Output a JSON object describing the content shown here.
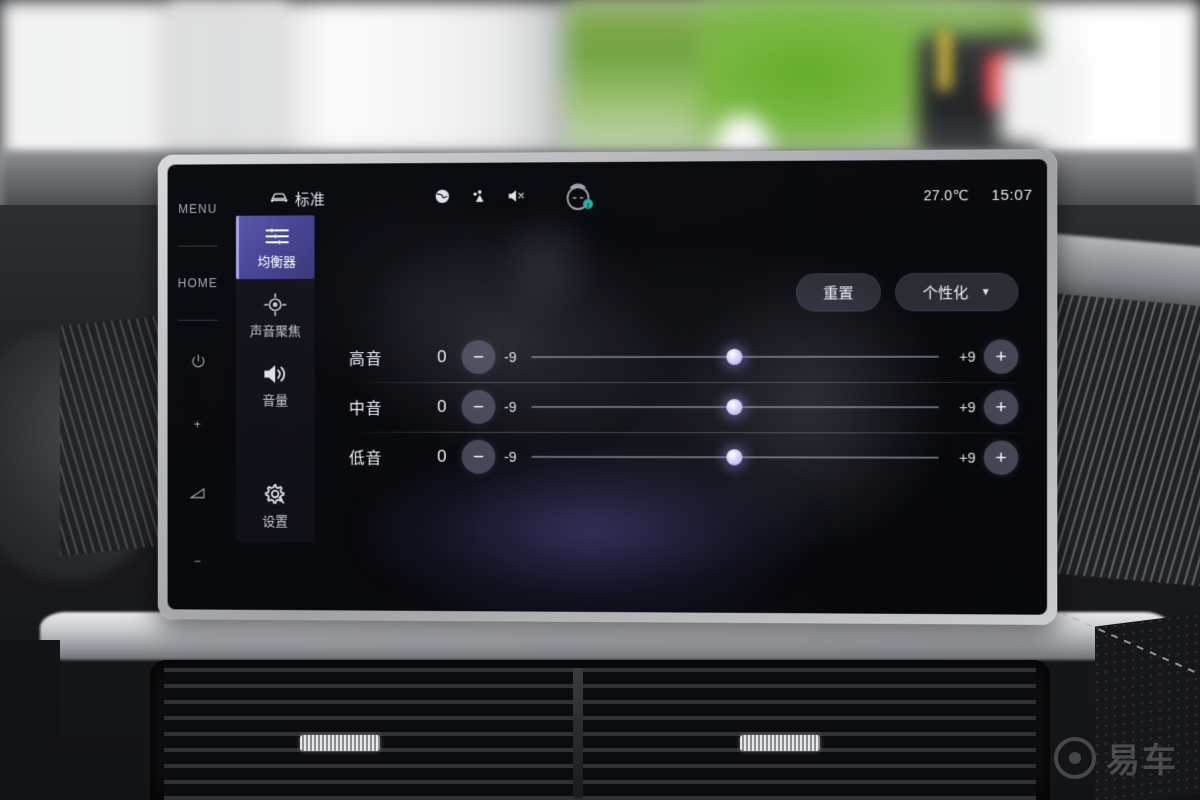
{
  "hardkeys": {
    "menu_label": "MENU",
    "home_label": "HOME",
    "power_icon": "power-icon",
    "plus_label": "+",
    "wedge_icon": "volume-wedge-icon",
    "minus_label": "−"
  },
  "statusbar": {
    "car_icon": "car-icon",
    "mode_label": "标准",
    "icons": [
      "globe-icon",
      "location-person-icon",
      "speaker-muted-icon"
    ],
    "avatar_icon": "face-avatar-icon",
    "avatar_badge": "!",
    "temperature": "27.0℃",
    "time": "15:07"
  },
  "nav": {
    "items": [
      {
        "label": "均衡器",
        "icon": "equalizer-icon",
        "active": true
      },
      {
        "label": "声音聚焦",
        "icon": "sound-focus-icon",
        "active": false
      },
      {
        "label": "音量",
        "icon": "volume-icon",
        "active": false
      },
      {
        "label": "设置",
        "icon": "settings-gear-icon",
        "active": false
      }
    ]
  },
  "actions": {
    "reset_label": "重置",
    "profile_label": "个性化",
    "caret_icon": "chevron-down-icon"
  },
  "equalizer": {
    "rows": [
      {
        "name": "高音",
        "value": "0",
        "min_label": "-9",
        "max_label": "+9",
        "minus": "−",
        "plus": "+",
        "percent": 50
      },
      {
        "name": "中音",
        "value": "0",
        "min_label": "-9",
        "max_label": "+9",
        "minus": "−",
        "plus": "+",
        "percent": 50
      },
      {
        "name": "低音",
        "value": "0",
        "min_label": "-9",
        "max_label": "+9",
        "minus": "−",
        "plus": "+",
        "percent": 50
      }
    ]
  },
  "watermark": {
    "text": "易车",
    "logo_icon": "yiche-logo-icon"
  },
  "colors": {
    "accent": "#a9a6ee",
    "nav_active_start": "#5a57a8",
    "nav_active_end": "#3b3a78",
    "badge_teal": "#19b8a8",
    "screen_bg": "#090a0e"
  }
}
